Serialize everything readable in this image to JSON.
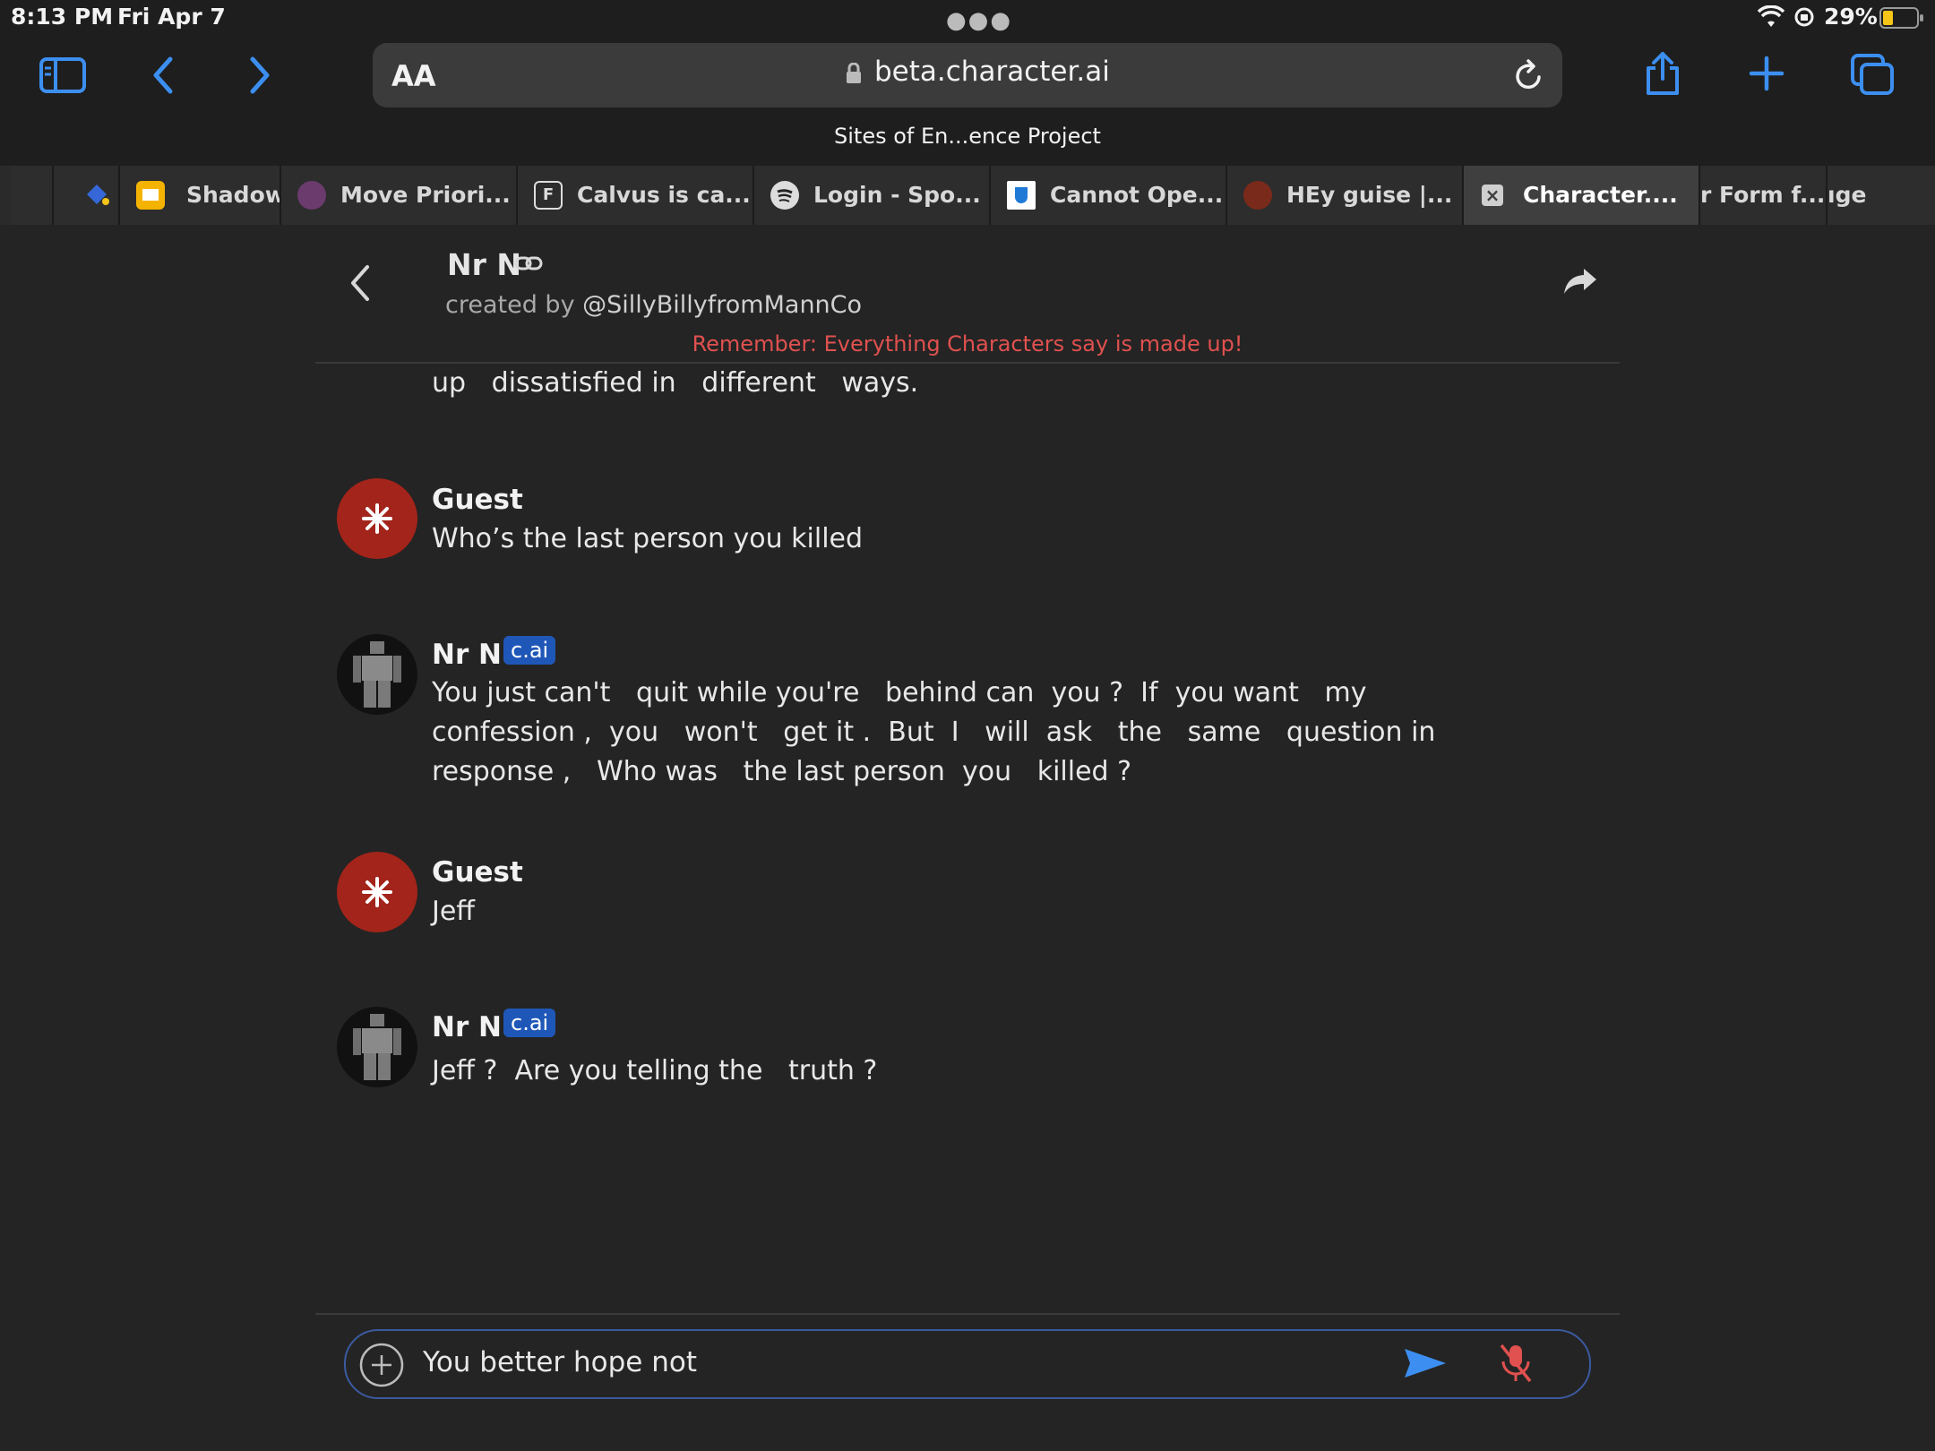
{
  "status": {
    "time": "8:13 PM",
    "date": "Fri Apr 7",
    "battery": "29%"
  },
  "browser": {
    "url_aa": "AA",
    "url": "beta.character.ai",
    "page_title": "Sites of En...ence Project",
    "tabs": [
      {
        "label": "Shadowi",
        "icon": "yellow-square-icon"
      },
      {
        "label": "Move Priori...",
        "icon": "character-icon"
      },
      {
        "label": "Calvus is ca...",
        "icon": "letter-f-icon"
      },
      {
        "label": "Login - Spo...",
        "icon": "spotify-icon"
      },
      {
        "label": "Cannot Ope...",
        "icon": "shield-icon"
      },
      {
        "label": "HEy guise |...",
        "icon": "character-icon"
      },
      {
        "label": "Character....",
        "icon": "close-icon"
      },
      {
        "label": "r Form f...",
        "icon": ""
      },
      {
        "label": "ıge",
        "icon": ""
      }
    ]
  },
  "chat": {
    "character_name": "Nr N",
    "created_by_prefix": "created by",
    "creator": "@SillyBillyfromMannCo",
    "disclaimer": "Remember: Everything Characters say is made up!",
    "partial_top_text": "up   dissatisfied in   different   ways.",
    "messages": [
      {
        "sender": "Guest",
        "type": "guest",
        "text": "Who’s the last person you killed"
      },
      {
        "sender": "Nr N",
        "type": "bot",
        "badge": "c.ai",
        "text": "You just can't   quit while you're   behind can  you ?  If  you want   my\nconfession ,  you   won't   get it .  But  I   will  ask   the   same   question in\nresponse ,   Who was   the last person  you   killed ?"
      },
      {
        "sender": "Guest",
        "type": "guest",
        "text": "Jeff"
      },
      {
        "sender": "Nr N",
        "type": "bot",
        "badge": "c.ai",
        "text": "Jeff ?  Are you telling the   truth ?"
      }
    ]
  },
  "composer": {
    "value": "You better hope not"
  },
  "colors": {
    "accent": "#3c8ff0",
    "disclaimer": "#e0514f",
    "guest_avatar": "#a3241a",
    "badge": "#1f57b8"
  }
}
